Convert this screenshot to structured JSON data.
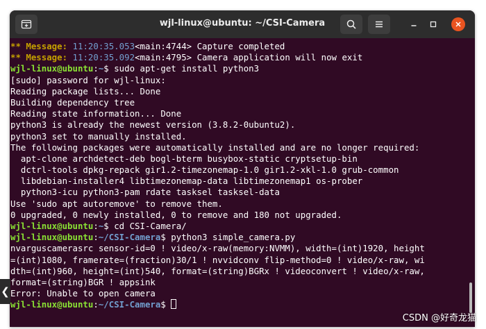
{
  "window": {
    "title": "wjl-linux@ubuntu: ~/CSI-Camera"
  },
  "titlebar": {
    "new_tab_icon": "new-tab-icon",
    "search_icon": "search-icon",
    "menu_icon": "hamburger-menu-icon",
    "minimize_icon": "minimize-icon",
    "maximize_icon": "maximize-icon",
    "close_icon": "close-icon"
  },
  "terminal": {
    "lines": [
      {
        "seg": [
          [
            "y",
            "** Message: "
          ],
          [
            "m",
            "11:20:35.053"
          ],
          [
            "",
            "<main:4744> Capture completed"
          ]
        ]
      },
      {
        "seg": [
          [
            "y",
            "** Message: "
          ],
          [
            "m",
            "11:20:35.092"
          ],
          [
            "",
            "<main:4795> Camera application will now exit"
          ]
        ]
      },
      {
        "seg": [
          [
            "g",
            "wjl-linux@ubuntu"
          ],
          [
            "",
            ":"
          ],
          [
            "b",
            "~"
          ],
          [
            "",
            "$ sudo apt-get install python3"
          ]
        ]
      },
      {
        "seg": [
          [
            "",
            "[sudo] password for wjl-linux:"
          ]
        ]
      },
      {
        "seg": [
          [
            "",
            "Reading package lists... Done"
          ]
        ]
      },
      {
        "seg": [
          [
            "",
            "Building dependency tree"
          ]
        ]
      },
      {
        "seg": [
          [
            "",
            "Reading state information... Done"
          ]
        ]
      },
      {
        "seg": [
          [
            "",
            "python3 is already the newest version (3.8.2-0ubuntu2)."
          ]
        ]
      },
      {
        "seg": [
          [
            "",
            "python3 set to manually installed."
          ]
        ]
      },
      {
        "seg": [
          [
            "",
            "The following packages were automatically installed and are no longer required:"
          ]
        ]
      },
      {
        "seg": [
          [
            "",
            "  apt-clone archdetect-deb bogl-bterm busybox-static cryptsetup-bin"
          ]
        ]
      },
      {
        "seg": [
          [
            "",
            "  dctrl-tools dpkg-repack gir1.2-timezonemap-1.0 gir1.2-xkl-1.0 grub-common"
          ]
        ]
      },
      {
        "seg": [
          [
            "",
            "  libdebian-installer4 libtimezonemap-data libtimezonemap1 os-prober"
          ]
        ]
      },
      {
        "seg": [
          [
            "",
            "  python3-icu python3-pam rdate tasksel tasksel-data"
          ]
        ]
      },
      {
        "seg": [
          [
            "",
            "Use 'sudo apt autoremove' to remove them."
          ]
        ]
      },
      {
        "seg": [
          [
            "",
            "0 upgraded, 0 newly installed, 0 to remove and 180 not upgraded."
          ]
        ]
      },
      {
        "seg": [
          [
            "g",
            "wjl-linux@ubuntu"
          ],
          [
            "",
            ":"
          ],
          [
            "b",
            "~"
          ],
          [
            "",
            "$ cd CSI-Camera/"
          ]
        ]
      },
      {
        "seg": [
          [
            "g",
            "wjl-linux@ubuntu"
          ],
          [
            "",
            ":"
          ],
          [
            "b",
            "~/CSI-Camera"
          ],
          [
            "",
            "$ python3 simple_camera.py"
          ]
        ]
      },
      {
        "seg": [
          [
            "",
            "nvarguscamerasrc sensor-id=0 ! video/x-raw(memory:NVMM), width=(int)1920, height"
          ]
        ]
      },
      {
        "seg": [
          [
            "",
            "=(int)1080, framerate=(fraction)30/1 ! nvvidconv flip-method=0 ! video/x-raw, wi"
          ]
        ]
      },
      {
        "seg": [
          [
            "",
            "dth=(int)960, height=(int)540, format=(string)BGRx ! videoconvert ! video/x-raw,"
          ]
        ]
      },
      {
        "seg": [
          [
            "",
            "format=(string)BGR ! appsink"
          ]
        ]
      },
      {
        "seg": [
          [
            "",
            "Error: Unable to open camera"
          ]
        ]
      },
      {
        "seg": [
          [
            "g",
            "wjl-linux@ubuntu"
          ],
          [
            "",
            ":"
          ],
          [
            "b",
            "~/CSI-Camera"
          ],
          [
            "",
            "$ "
          ]
        ],
        "cursor": true
      }
    ]
  },
  "side_arrow": "❮",
  "watermark": "CSDN @好奇龙猫",
  "colors": {
    "terminal_bg": "#300a24",
    "prompt_user": "#8ae234",
    "prompt_path": "#729fcf",
    "message_tag": "#c4a000",
    "close_button": "#e95420"
  }
}
